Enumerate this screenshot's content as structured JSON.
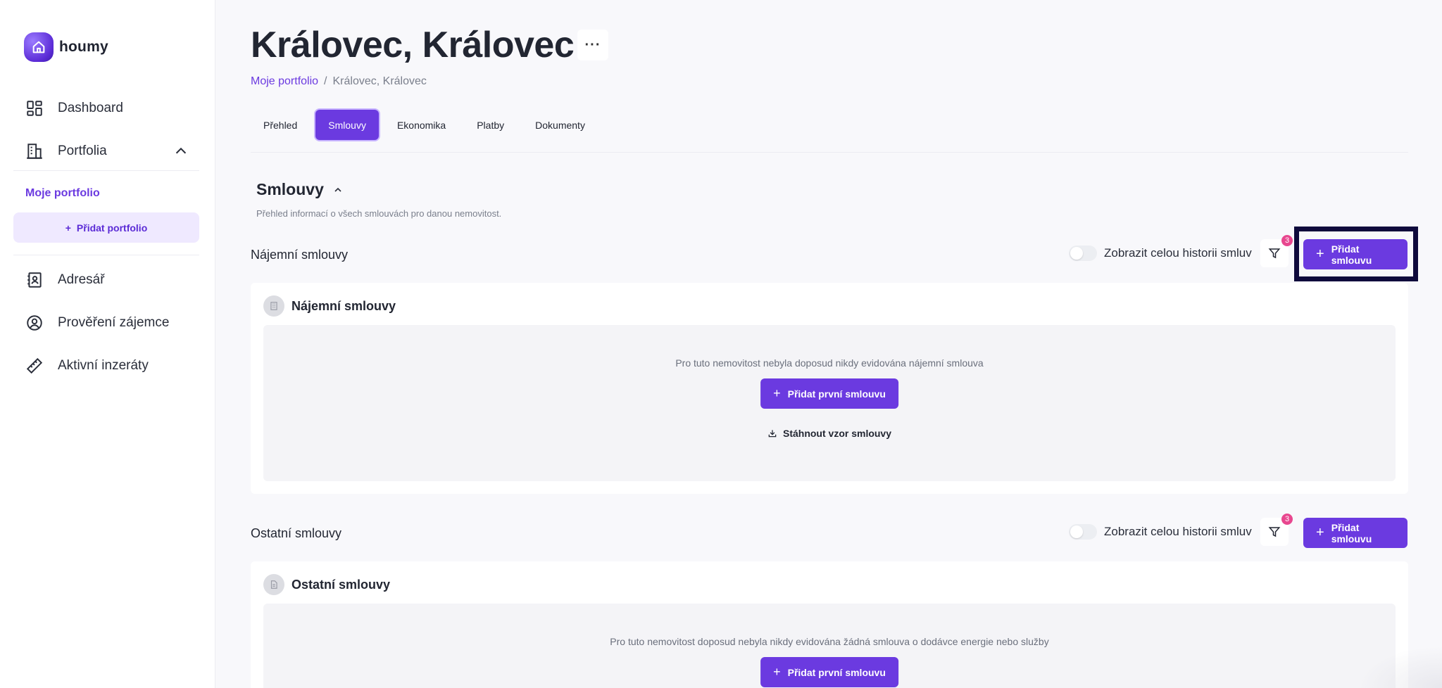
{
  "app": {
    "logo_text": "houmy"
  },
  "sidebar": {
    "items": [
      {
        "label": "Dashboard",
        "icon": "dashboard-grid-icon"
      },
      {
        "label": "Portfolia",
        "icon": "building-icon"
      },
      {
        "label": "Adresář",
        "icon": "address-book-icon"
      },
      {
        "label": "Prověření zájemce",
        "icon": "user-check-icon"
      },
      {
        "label": "Aktivní inzeráty",
        "icon": "ruler-icon"
      }
    ],
    "sub_item": "Moje portfolio",
    "add_portfolio": "Přidat portfolio"
  },
  "header": {
    "title": "Královec, Královec",
    "more": "···",
    "breadcrumb": {
      "root": "Moje portfolio",
      "sep": "/",
      "current": "Královec, Královec"
    }
  },
  "tabs": [
    {
      "label": "Přehled",
      "active": false
    },
    {
      "label": "Smlouvy",
      "active": true
    },
    {
      "label": "Ekonomika",
      "active": false
    },
    {
      "label": "Platby",
      "active": false
    },
    {
      "label": "Dokumenty",
      "active": false
    }
  ],
  "section": {
    "title": "Smlouvy",
    "description": "Přehled informací o všech smlouvách pro danou nemovitost."
  },
  "lease": {
    "row_title": "Nájemní smlouvy",
    "toggle_label": "Zobrazit celou historii smluv",
    "filter_badge": "3",
    "add_button": "Přidat smlouvu",
    "card_title": "Nájemní smlouvy",
    "empty_text": "Pro tuto nemovitost nebyla doposud nikdy evidována nájemní smlouva",
    "add_first": "Přidat první smlouvu",
    "download": "Stáhnout vzor smlouvy"
  },
  "other": {
    "row_title": "Ostatní smlouvy",
    "toggle_label": "Zobrazit celou historii smluv",
    "filter_badge": "3",
    "add_button": "Přidat smlouvu",
    "card_title": "Ostatní smlouvy",
    "empty_text": "Pro tuto nemovitost doposud nebyla nikdy evidována žádná smlouva o dodávce energie nebo služby",
    "add_first": "Přidat první smlouvu"
  },
  "colors": {
    "accent": "#6b3ae0",
    "badge": "#e8478f",
    "highlight": "#0f0a3c"
  }
}
